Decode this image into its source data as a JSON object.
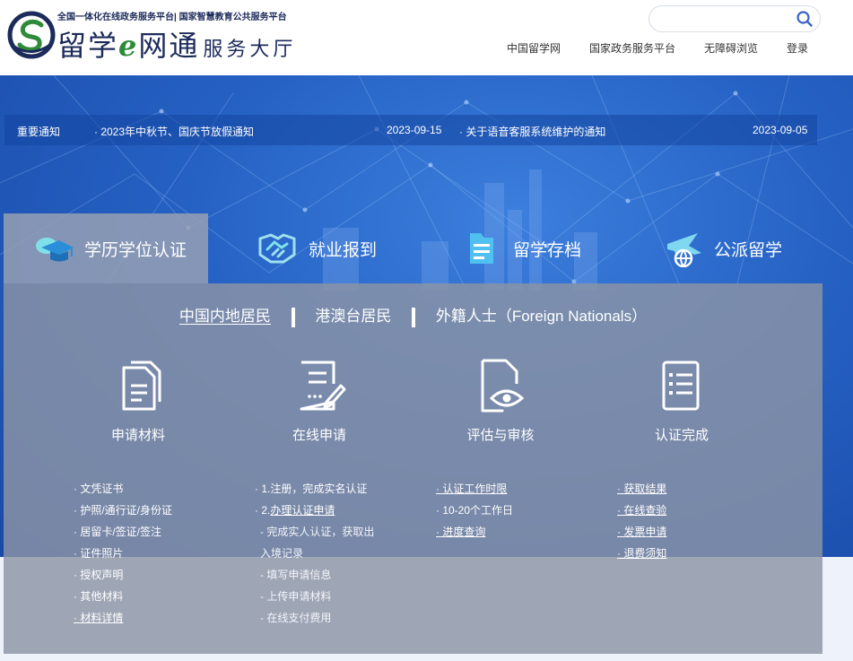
{
  "header": {
    "logo_sub": "全国一体化在线政务服务平台| 国家智慧教育公共服务平台",
    "logo_main_1": "留学",
    "logo_main_e": "e",
    "logo_main_2": "网通",
    "logo_hall": "服务大厅",
    "search": {
      "placeholder": "",
      "value": ""
    },
    "nav": [
      "中国留学网",
      "国家政务服务平台",
      "无障碍浏览",
      "登录"
    ]
  },
  "notice": {
    "label": "重要通知",
    "items": [
      {
        "title": "· 2023年中秋节、国庆节放假通知",
        "date": "2023-09-15"
      },
      {
        "title": "· 关于语音客服系统维护的通知",
        "date": "2023-09-05"
      }
    ]
  },
  "tabs": [
    {
      "label": "学历学位认证",
      "icon": "graduation-cap-icon",
      "active": true
    },
    {
      "label": "就业报到",
      "icon": "handshake-icon",
      "active": false
    },
    {
      "label": "留学存档",
      "icon": "archive-folder-icon",
      "active": false
    },
    {
      "label": "公派留学",
      "icon": "airplane-globe-icon",
      "active": false
    }
  ],
  "subtabs": [
    "中国内地居民",
    "港澳台居民",
    "外籍人士（Foreign Nationals）"
  ],
  "steps": [
    {
      "label": "申请材料",
      "icon": "documents-icon"
    },
    {
      "label": "在线申请",
      "icon": "edit-form-icon"
    },
    {
      "label": "评估与审核",
      "icon": "review-eye-icon"
    },
    {
      "label": "认证完成",
      "icon": "completed-list-icon"
    }
  ],
  "columns": {
    "materials": [
      "· 文凭证书",
      "· 护照/通行证/身份证",
      "· 居留卡/签证/签注",
      "· 证件照片",
      "· 授权声明",
      "· 其他材料",
      "· 材料详情"
    ],
    "online": {
      "step1": "· 1.注册，完成实名认证",
      "step2_prefix": "· 2.",
      "step2_link": "办理认证申请",
      "sub1a": "- 完成实人认证，获取出",
      "sub1b": "入境记录",
      "sub2": "- 填写申请信息",
      "sub3": "- 上传申请材料",
      "sub4": "- 在线支付费用"
    },
    "review": [
      "· 认证工作时限",
      "· 10-20个工作日",
      "· 进度查询"
    ],
    "complete": [
      "· 获取结果",
      "· 在线查验",
      "· 发票申请",
      "· 退费须知"
    ]
  },
  "colors": {
    "banner": "#2561c3",
    "panel": "#8c94a5",
    "brand_navy": "#1c2b5a",
    "brand_green": "#2e8b3a",
    "search_icon": "#3a64c8"
  }
}
